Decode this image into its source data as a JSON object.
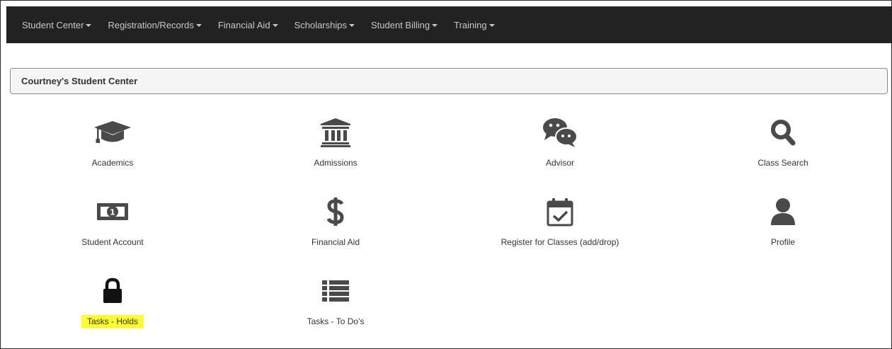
{
  "navbar": {
    "items": [
      {
        "label": "Student Center"
      },
      {
        "label": "Registration/Records"
      },
      {
        "label": "Financial Aid"
      },
      {
        "label": "Scholarships"
      },
      {
        "label": "Student Billing"
      },
      {
        "label": "Training"
      }
    ]
  },
  "panel": {
    "title": "Courtney's Student Center"
  },
  "tiles": [
    {
      "label": "Academics",
      "icon": "graduation-cap-icon"
    },
    {
      "label": "Admissions",
      "icon": "institution-icon"
    },
    {
      "label": "Advisor",
      "icon": "chat-bubbles-icon"
    },
    {
      "label": "Class Search",
      "icon": "search-icon"
    },
    {
      "label": "Student Account",
      "icon": "money-icon"
    },
    {
      "label": "Financial Aid",
      "icon": "dollar-icon"
    },
    {
      "label": "Register for Classes (add/drop)",
      "icon": "calendar-check-icon"
    },
    {
      "label": "Profile",
      "icon": "user-icon"
    },
    {
      "label": "Tasks - Holds",
      "icon": "lock-icon"
    },
    {
      "label": "Tasks - To Do's",
      "icon": "list-icon"
    }
  ],
  "colors": {
    "navbar_bg": "#222222",
    "nav_text": "#c8c8c8",
    "icon": "#4a4a4a",
    "highlight": "#ffff33"
  }
}
